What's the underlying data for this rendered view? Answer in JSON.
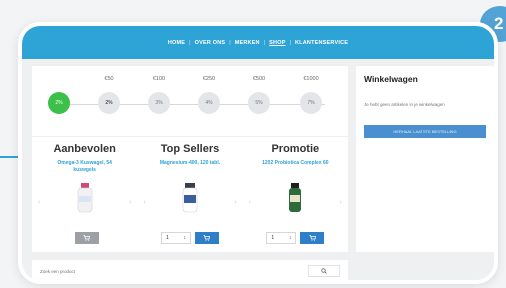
{
  "badge": "2",
  "nav": {
    "items": [
      {
        "label": "HOME"
      },
      {
        "label": "OVER ONS"
      },
      {
        "label": "MERKEN"
      },
      {
        "label": "SHOP"
      },
      {
        "label": "KLANTENSERVICE"
      }
    ],
    "active": "SHOP"
  },
  "tiers": [
    {
      "amount": "",
      "discount": "2%"
    },
    {
      "amount": "€50",
      "discount": "2%"
    },
    {
      "amount": "€100",
      "discount": "3%"
    },
    {
      "amount": "€250",
      "discount": "4%"
    },
    {
      "amount": "€500",
      "discount": "5%"
    },
    {
      "amount": "€1000",
      "discount": "7%"
    }
  ],
  "products": [
    {
      "heading": "Aanbevolen",
      "name": "Omega-3 Kuswagel, 54 kuswgels",
      "qty": "",
      "bottle_color": "#f1f1f4",
      "cap_color": "#d04a7a",
      "disabled": true
    },
    {
      "heading": "Top Sellers",
      "name": "Magnesium-400, 120 tabl.",
      "qty": "1",
      "bottle_color": "#ffffff",
      "cap_color": "#3a3f4a",
      "disabled": false
    },
    {
      "heading": "Promotie",
      "name": "1202 Probiotica Complex 60",
      "qty": "1",
      "bottle_color": "#2f6b3a",
      "cap_color": "#1f1f1f",
      "disabled": false
    }
  ],
  "cart": {
    "title": "Winkelwagen",
    "empty_text": "Je hebt geen artikelen in je winkelwagen",
    "order_button": "HERHAAL LAATSTE BESTELLING"
  },
  "search": {
    "placeholder": "Zoek een product"
  },
  "colors": {
    "brand": "#2ea3d6",
    "active_tier": "#3cc04a",
    "cart_button": "#2e7fc8"
  }
}
